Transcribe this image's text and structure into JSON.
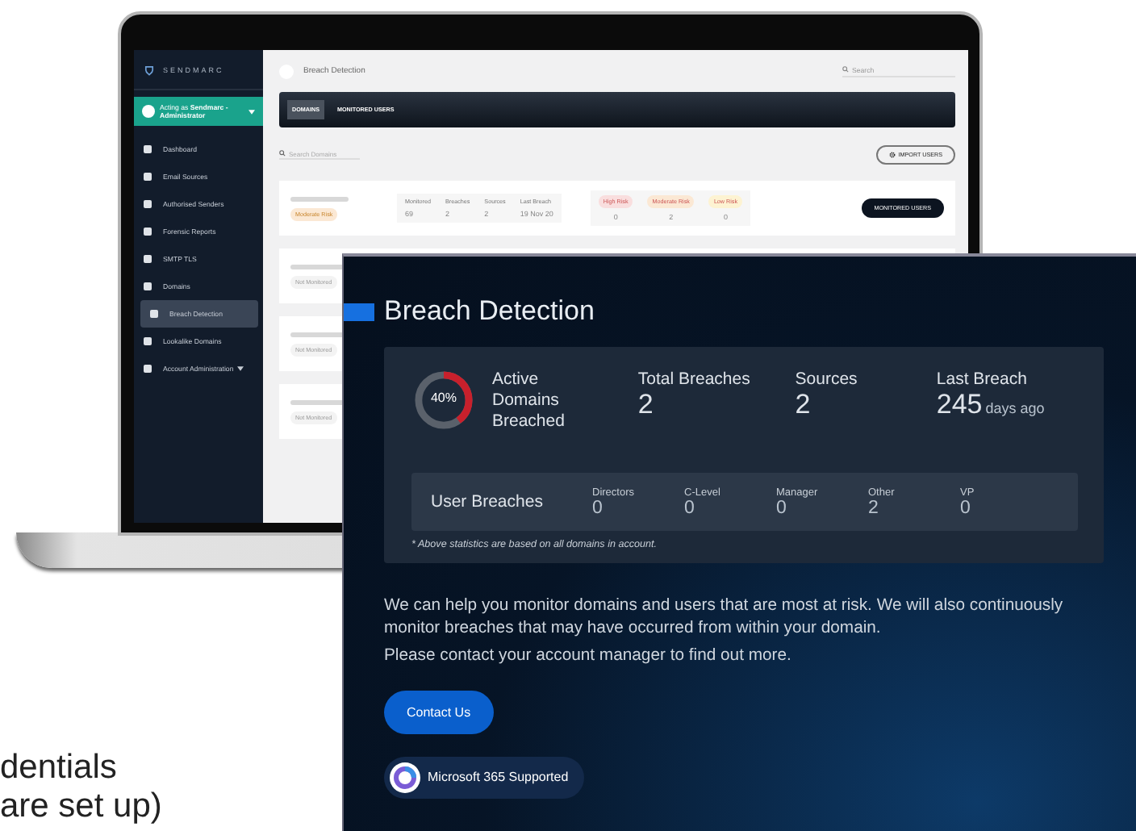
{
  "laptop": {
    "brand": "SENDMARC",
    "acting_as": "Acting as **Sendmarc - Administrator**",
    "sidebar": {
      "items": [
        {
          "label": "Dashboard",
          "selected": false
        },
        {
          "label": "Email Sources",
          "selected": false
        },
        {
          "label": "Authorised Senders",
          "selected": false
        },
        {
          "label": "Forensic Reports",
          "selected": false
        },
        {
          "label": "SMTP TLS",
          "selected": false
        },
        {
          "label": "Domains",
          "selected": false
        },
        {
          "label": "Breach Detection",
          "selected": true
        },
        {
          "label": "Lookalike Domains",
          "selected": false
        },
        {
          "label": "Account Administration",
          "selected": false,
          "caret": true
        }
      ]
    },
    "page_title": "Breach Detection",
    "search": {
      "placeholder": "Search"
    },
    "tabs": [
      {
        "label": "DOMAINS",
        "selected": true
      },
      {
        "label": "MONITORED USERS",
        "selected": false
      }
    ],
    "domain_search": {
      "placeholder": "Search Domains"
    },
    "import_button": "IMPORT USERS",
    "rows": [
      {
        "status": "Moderate Risk",
        "kind": "full",
        "stats": [
          {
            "label": "Monitored",
            "value": "69"
          },
          {
            "label": "Breaches",
            "value": "2"
          },
          {
            "label": "Sources",
            "value": "2"
          },
          {
            "label": "Last Breach",
            "value": "19 Nov 20"
          }
        ],
        "risks": [
          {
            "label": "High Risk",
            "value": "0",
            "color": "#f9dede"
          },
          {
            "label": "Moderate Risk",
            "value": "2",
            "color": "#fbe8d4"
          },
          {
            "label": "Low Risk",
            "value": "0",
            "color": "#fdf3d2"
          }
        ],
        "button": "MONITORED USERS"
      },
      {
        "status": "Not Monitored",
        "kind": "short"
      },
      {
        "status": "Not Monitored",
        "kind": "short"
      },
      {
        "status": "Not Monitored",
        "kind": "short"
      }
    ]
  },
  "panel": {
    "title": "Breach Detection",
    "donut": {
      "reading": "40%",
      "level": 0.4
    },
    "donut_label": "Active Domains Breached",
    "stats": [
      {
        "label": "Total Breaches",
        "value": "2"
      },
      {
        "label": "Sources",
        "value": "2"
      },
      {
        "label": "Last Breach",
        "value": "245",
        "unit": "days ago"
      }
    ],
    "user_breaches": {
      "label": "User Breaches",
      "items": [
        {
          "label": "Directors",
          "value": "0"
        },
        {
          "label": "C-Level",
          "value": "0"
        },
        {
          "label": "Manager",
          "value": "0"
        },
        {
          "label": "Other",
          "value": "2"
        },
        {
          "label": "VP",
          "value": "0"
        }
      ]
    },
    "note": "* Above statistics are based on all domains in account.",
    "paragraphs": [
      "We can help you monitor domains and users that are most at risk. We will also continuously monitor breaches that may have occurred from within your domain.",
      "Please contact your account manager to find out more."
    ],
    "button": "Contact Us",
    "badge": "Microsoft 365 Supported"
  },
  "background_text": [
    "dentials",
    "are set up)"
  ]
}
